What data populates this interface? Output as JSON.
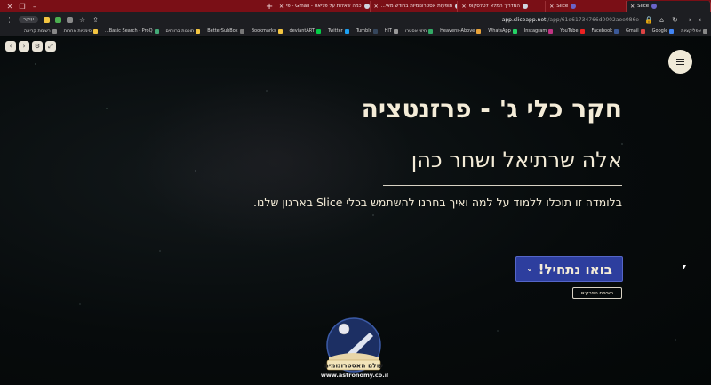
{
  "browser": {
    "tabs": [
      {
        "label": "Slice",
        "active": true
      },
      {
        "label": "Slice",
        "active": false
      },
      {
        "label": "המדריך המלא לטלסקופ",
        "active": false
      },
      {
        "label": "תופעות אסטרונומיות בחודש מאי...",
        "active": false
      },
      {
        "label": "כמה שאלות על פליאט - Gmail - פי",
        "active": false
      }
    ],
    "profile_label": "עוקב",
    "url_host": "app.sliceapp.net",
    "url_path": "/app/61d61734766d0002aee086e"
  },
  "bookmarks": [
    "אפליקציות",
    "Google",
    "Gmail",
    "Facebook",
    "YouTube",
    "Instagram",
    "WhatsApp",
    "Heavens-Above",
    "חיזוי אסטרו",
    "HIT",
    "Tumblr",
    "Twitter",
    "deviantART",
    "Bookmarks",
    "BetterSubBox",
    "תוכנות ברווחים",
    "Basic Search - ProQ...",
    "סימניות אחרות",
    "רשימת קריאה"
  ],
  "slide": {
    "title": "חקר כלי ג' - פרזנטציה",
    "subtitle": "אלה שרתיאל ושחר כהן",
    "description": "בלומדה זו תוכלו ללמוד על למה ואיך בחרנו להשתמש בכלי Slice בארגון שלנו.",
    "cta_label": "בואו נתחיל!",
    "toc_label": "רשימת הפרקים",
    "logo_text": "עולם האסטרונומיה",
    "logo_url": "www.astronomy.co.il"
  },
  "colors": {
    "tab_bar": "#7a0f16",
    "cta_bg": "#2d3e9e",
    "text": "#f4ecd8"
  },
  "icons": [
    "back-icon",
    "forward-icon",
    "reload-icon",
    "home-icon",
    "star-icon",
    "menu-icon",
    "chevron-down-icon"
  ]
}
